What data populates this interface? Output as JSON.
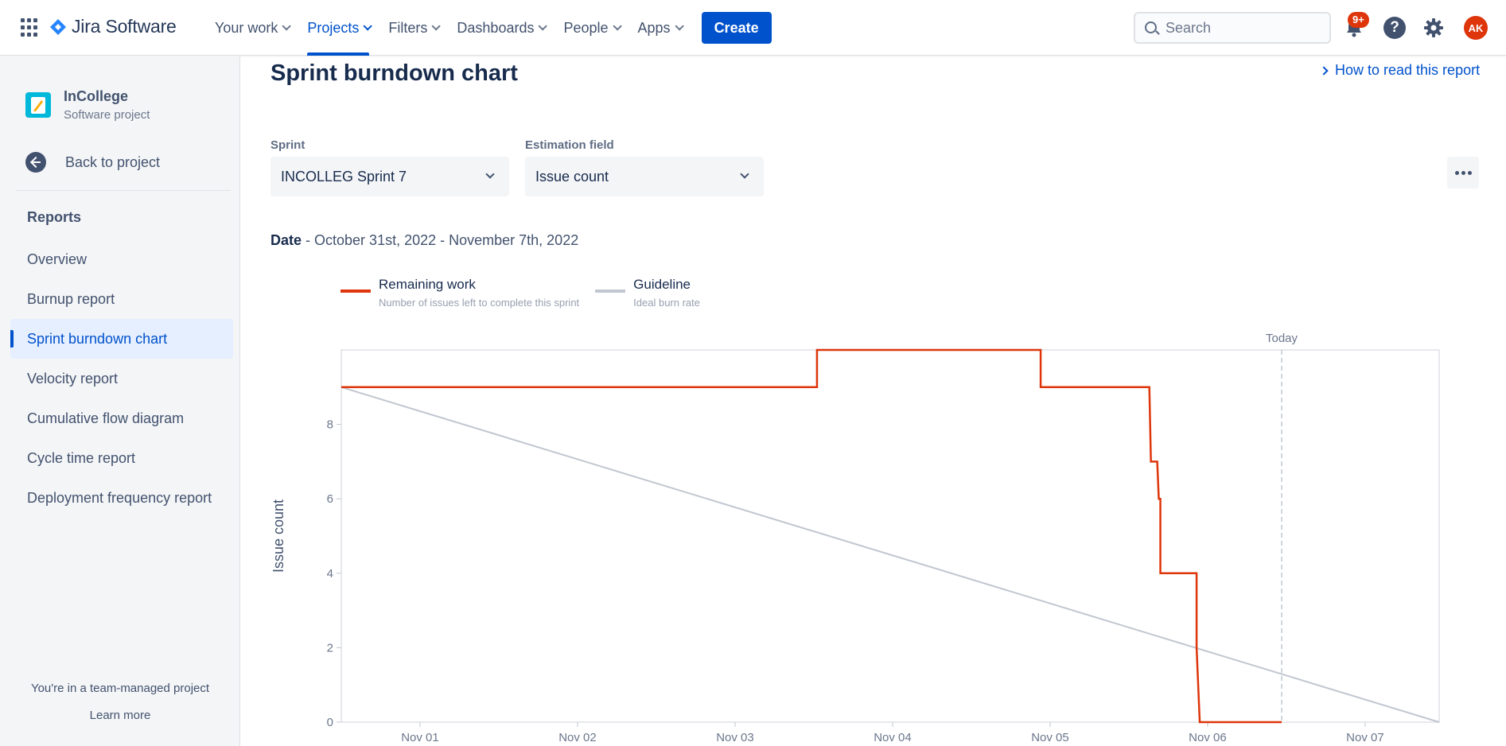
{
  "topnav": {
    "product": "Jira Software",
    "items": [
      {
        "label": "Your work",
        "active": false
      },
      {
        "label": "Projects",
        "active": true
      },
      {
        "label": "Filters",
        "active": false
      },
      {
        "label": "Dashboards",
        "active": false
      },
      {
        "label": "People",
        "active": false
      },
      {
        "label": "Apps",
        "active": false
      }
    ],
    "create_label": "Create",
    "search_placeholder": "Search",
    "notification_badge": "9+",
    "help_glyph": "?",
    "avatar_initials": "AK",
    "icons": [
      "app-switcher-icon",
      "jira-logo-icon",
      "search-icon",
      "notifications-icon",
      "help-icon",
      "settings-icon"
    ]
  },
  "sidebar": {
    "project_name": "InCollege",
    "project_type": "Software project",
    "back_label": "Back to project",
    "section_heading": "Reports",
    "items": [
      {
        "label": "Overview",
        "active": false
      },
      {
        "label": "Burnup report",
        "active": false
      },
      {
        "label": "Sprint burndown chart",
        "active": true
      },
      {
        "label": "Velocity report",
        "active": false
      },
      {
        "label": "Cumulative flow diagram",
        "active": false
      },
      {
        "label": "Cycle time report",
        "active": false
      },
      {
        "label": "Deployment frequency report",
        "active": false
      }
    ],
    "team_note": "You're in a team-managed project",
    "learn_more": "Learn more"
  },
  "main": {
    "title": "Sprint burndown chart",
    "how_to_link": "How to read this report",
    "sprint_label": "Sprint",
    "sprint_value": "INCOLLEG Sprint 7",
    "estimation_label": "Estimation field",
    "estimation_value": "Issue count",
    "date_label": "Date",
    "date_value": "- October 31st, 2022 - November 7th, 2022",
    "legend": [
      {
        "name": "Remaining work",
        "sub": "Number of issues left to complete this sprint",
        "color": "#de350b"
      },
      {
        "name": "Guideline",
        "sub": "Ideal burn rate",
        "color": "#c1c7d0"
      }
    ]
  },
  "colors": {
    "accent": "#0052cc",
    "remaining": "#de350b",
    "guideline": "#c1c7d0"
  },
  "chart_data": {
    "type": "line",
    "ylabel": "Issue count",
    "xlabel": "",
    "xlim": [
      0,
      6.97
    ],
    "ylim": [
      0,
      10
    ],
    "x_ticks": [
      {
        "x": 0.5,
        "label": "Nov 01"
      },
      {
        "x": 1.5,
        "label": "Nov 02"
      },
      {
        "x": 2.5,
        "label": "Nov 03"
      },
      {
        "x": 3.5,
        "label": "Nov 04"
      },
      {
        "x": 4.5,
        "label": "Nov 05"
      },
      {
        "x": 5.5,
        "label": "Nov 06"
      },
      {
        "x": 6.5,
        "label": "Nov 07"
      }
    ],
    "y_ticks": [
      0,
      2,
      4,
      6,
      8
    ],
    "today_x": 5.97,
    "today_label": "Today",
    "series": [
      {
        "name": "Remaining work",
        "step": true,
        "points": [
          [
            0,
            9
          ],
          [
            3.02,
            9
          ],
          [
            3.02,
            10
          ],
          [
            4.44,
            10
          ],
          [
            4.44,
            9
          ],
          [
            5.13,
            9
          ],
          [
            5.14,
            7
          ],
          [
            5.18,
            7
          ],
          [
            5.19,
            6
          ],
          [
            5.2,
            6
          ],
          [
            5.2,
            4
          ],
          [
            5.43,
            4
          ],
          [
            5.43,
            2
          ],
          [
            5.45,
            0
          ],
          [
            5.97,
            0
          ]
        ]
      },
      {
        "name": "Guideline",
        "points": [
          [
            0,
            9
          ],
          [
            6.97,
            0
          ]
        ]
      }
    ]
  }
}
